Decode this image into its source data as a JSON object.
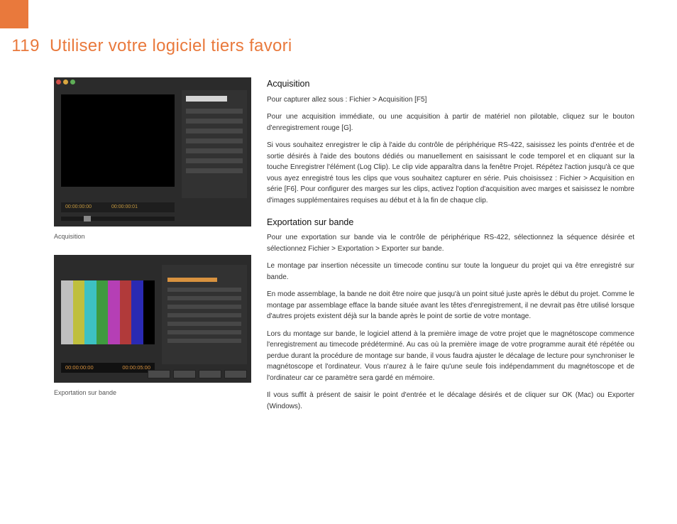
{
  "page_number": "119",
  "title": "Utiliser votre logiciel tiers favori",
  "figure1": {
    "caption": "Acquisition",
    "timecodes": [
      "00:00:00:00",
      "00:00:00:01"
    ]
  },
  "figure2": {
    "caption": "Exportation sur bande",
    "timecodes": [
      "00:00:00:00",
      "00:00:05:00"
    ]
  },
  "sections": [
    {
      "heading": "Acquisition",
      "paragraphs": [
        "Pour capturer allez sous : Fichier > Acquisition [F5]",
        "Pour une acquisition immédiate, ou une acquisition à partir de matériel non pilotable, cliquez sur le bouton d'enregistrement rouge [G].",
        "Si vous souhaitez enregistrer le clip à l'aide du contrôle de périphérique RS-422, saisissez les points d'entrée et de sortie désirés à l'aide des boutons dédiés ou manuellement en saisissant le code temporel et en cliquant sur la touche Enregistrer l'élément (Log Clip). Le clip vide apparaîtra dans la fenêtre Projet. Répétez l'action jusqu'à ce que vous ayez enregistré tous les clips que vous souhaitez capturer en série. Puis choisissez : Fichier > Acquisition en série [F6]. Pour configurer des marges sur les clips, activez l'option d'acquisition avec marges et saisissez le nombre d'images supplémentaires requises au début et à la fin de chaque clip."
      ]
    },
    {
      "heading": "Exportation sur bande",
      "paragraphs": [
        "Pour une exportation sur bande via le contrôle de périphérique RS-422, sélectionnez la séquence désirée et sélectionnez Fichier > Exportation > Exporter sur bande.",
        "Le montage par insertion nécessite un timecode continu sur toute la longueur du projet qui va être enregistré sur bande.",
        "En mode assemblage, la bande ne doit être noire que jusqu'à un point situé juste après le début du projet. Comme le montage par assemblage efface la bande située avant les têtes d'enregistrement, il ne devrait pas être utilisé lorsque d'autres projets existent déjà sur la bande après le point de sortie de votre montage.",
        "Lors du montage sur bande, le logiciel attend à la première image de votre projet que le magnétoscope commence l'enregistrement au timecode prédéterminé. Au cas où la première image de votre programme aurait été répétée ou perdue durant la procédure de montage sur bande, il vous faudra ajuster le décalage de lecture pour synchroniser le magnétoscope et l'ordinateur. Vous n'aurez à le faire qu'une seule fois indépendamment du magnétoscope et de l'ordinateur car ce paramètre sera gardé en mémoire.",
        "Il vous suffit à présent de saisir le point d'entrée et le décalage désirés et de cliquer sur OK (Mac) ou Exporter (Windows)."
      ]
    }
  ]
}
